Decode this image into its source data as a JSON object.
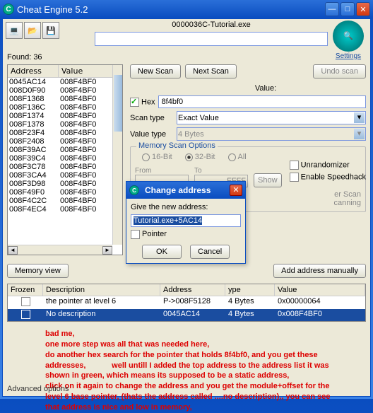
{
  "window": {
    "title": "Cheat Engine 5.2"
  },
  "exe": {
    "name": "0000036C-Tutorial.exe"
  },
  "logo": {
    "settings": "Settings"
  },
  "found": {
    "label": "Found:",
    "count": "36"
  },
  "addrlist": {
    "col1": "Address",
    "col2": "Value",
    "rows": [
      {
        "a": "0045AC14",
        "v": "008F4BF0"
      },
      {
        "a": "008D0F90",
        "v": "008F4BF0"
      },
      {
        "a": "008F1368",
        "v": "008F4BF0"
      },
      {
        "a": "008F136C",
        "v": "008F4BF0"
      },
      {
        "a": "008F1374",
        "v": "008F4BF0"
      },
      {
        "a": "008F1378",
        "v": "008F4BF0"
      },
      {
        "a": "008F23F4",
        "v": "008F4BF0"
      },
      {
        "a": "008F2408",
        "v": "008F4BF0"
      },
      {
        "a": "008F39AC",
        "v": "008F4BF0"
      },
      {
        "a": "008F39C4",
        "v": "008F4BF0"
      },
      {
        "a": "008F3C78",
        "v": "008F4BF0"
      },
      {
        "a": "008F3CA4",
        "v": "008F4BF0"
      },
      {
        "a": "008F3D98",
        "v": "008F4BF0"
      },
      {
        "a": "008F49F0",
        "v": "008F4BF0"
      },
      {
        "a": "008F4C2C",
        "v": "008F4BF0"
      },
      {
        "a": "008F4EC4",
        "v": "008F4BF0"
      }
    ]
  },
  "scan": {
    "new": "New Scan",
    "next": "Next Scan",
    "undo": "Undo scan",
    "value_label": "Value:",
    "hex": "Hex",
    "value_input": "8f4bf0",
    "scantype_label": "Scan type",
    "scantype_val": "Exact Value",
    "valuetype_label": "Value type",
    "valuetype_val": "4 Bytes"
  },
  "mso": {
    "title": "Memory Scan Options",
    "r16": "16-Bit",
    "r32": "32-Bit",
    "rall": "All",
    "from": "From",
    "to": "To",
    "from_val": "",
    "to_val": "FFFF",
    "show": "Show",
    "l1": "er Scan",
    "l2": "canning"
  },
  "sidechk": {
    "unr": "Unrandomizer",
    "spd": "Enable Speedhack"
  },
  "memview": "Memory view",
  "addman": "Add address manually",
  "table": {
    "col_frozen": "Frozen",
    "col_desc": "Description",
    "col_addr": "Address",
    "col_type": "ype",
    "col_val": "Value",
    "rows": [
      {
        "desc": "the pointer at level 6",
        "addr": "P->008F5128",
        "type": "4 Bytes",
        "val": "0x00000064",
        "sel": false
      },
      {
        "desc": "No description",
        "addr": "0045AC14",
        "type": "4 Bytes",
        "val": "0x008F4BF0",
        "sel": true
      }
    ]
  },
  "notes": {
    "l1": "bad me,",
    "l2": "one more step was all that was needed here,",
    "l3": "do another hex search for the pointer that holds 8f4bf0, and you get these",
    "l4a": "addresses,",
    "l4b": "well untill I added the top address to the address list it was",
    "l5": "shown in green, which means its supposed to be a static address,",
    "l6": "click on it again to change the address and you get the module+offset for the",
    "l7": "level 6 base pointer, (thats the address called ....no description),, you can see",
    "l8": "that address is nice and low in memory,"
  },
  "adv": "Advanced options",
  "dialog": {
    "title": "Change address",
    "prompt": "Give the new address:",
    "input": "Tutorial.exe+5AC14",
    "pointer": "Pointer",
    "ok": "OK",
    "cancel": "Cancel"
  }
}
